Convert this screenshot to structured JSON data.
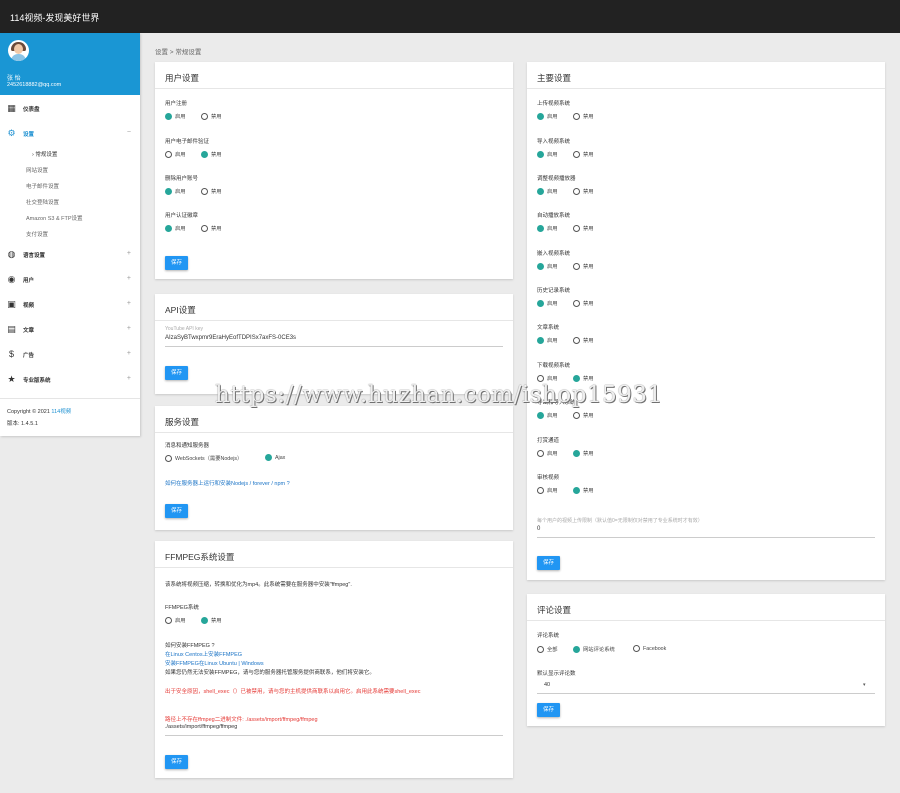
{
  "app_title": "114视频-发现美好世界",
  "user": {
    "name": "张 怡",
    "email": "2452618882@qq.com"
  },
  "sidebar": {
    "items": [
      {
        "label": "仪表盘",
        "sign": ""
      },
      {
        "label": "设置",
        "sign": "−"
      },
      {
        "label": "语言设置",
        "sign": "+"
      },
      {
        "label": "用户",
        "sign": "+"
      },
      {
        "label": "视频",
        "sign": "+"
      },
      {
        "label": "文章",
        "sign": "+"
      },
      {
        "label": "广告",
        "sign": "+"
      },
      {
        "label": "专业版系统",
        "sign": "+"
      }
    ],
    "sub_items": [
      "› 常规设置",
      "网站设置",
      "电子邮件设置",
      "社交登陆设置",
      "Amazon S3 & FTP设置",
      "支付设置"
    ],
    "copyright_prefix": "Copyright © 2021",
    "copyright_link": "114视频",
    "version": "版本: 1.4.5.1"
  },
  "breadcrumb": "设置 > 常规设置",
  "save_label": "保存",
  "user_settings": {
    "title": "用户设置",
    "fields": [
      {
        "label": "用户注册",
        "options": [
          "启用",
          "禁用"
        ],
        "selected": 0
      },
      {
        "label": "用户电子邮件验证",
        "options": [
          "启用",
          "禁用"
        ],
        "selected": 1
      },
      {
        "label": "删除用户账号",
        "options": [
          "启用",
          "禁用"
        ],
        "selected": 0
      },
      {
        "label": "用户认证徽章",
        "options": [
          "启用",
          "禁用"
        ],
        "selected": 0
      }
    ]
  },
  "api_settings": {
    "title": "API设置",
    "placeholder": "YouTube API key",
    "value": "AIzaSyBTwxpmr9EraHyEofTDPISx7axFS-0CE3s"
  },
  "server_settings": {
    "title": "服务设置",
    "field_label": "消息和通知服务器",
    "options": [
      "WebSockets（需要Nodejs）",
      "Ajax"
    ],
    "selected": 1,
    "link": "如何在服务器上运行和安装Nodejs / forever / npm ?"
  },
  "ffmpeg_settings": {
    "title": "FFMPEG系统设置",
    "intro": "该系统将视频压缩，转换和优化为mp4。此系统需要在服务器中安装\"ffmpeg\".",
    "field_label": "FFMPEG系统",
    "options": [
      "启用",
      "禁用"
    ],
    "selected": 1,
    "how_to": "如何安装FFMPEG ?",
    "link1": "在Linux Centos上安装FFMPEG",
    "link2": "安装FFMPEG在Linux Ubuntu | Windows",
    "note": "如果您仍然无法安装FFMPEG，请与您的服务器托管服务提供商联系，他们将安装它。",
    "warning": "出于安全原因，shell_exec（）已被禁用，请与您的主机提供商联系以启用它。启用此系统需要shell_exec",
    "error": "路径上不存在ffmpeg二进制文件: ./assets/import/ffmpeg/ffmpeg",
    "path_value": "./assets/import/ffmpeg/ffmpeg"
  },
  "main_settings": {
    "title": "主要设置",
    "fields": [
      {
        "label": "上传视频系统",
        "options": [
          "启用",
          "禁用"
        ],
        "selected": 0
      },
      {
        "label": "导入视频系统",
        "options": [
          "启用",
          "禁用"
        ],
        "selected": 0
      },
      {
        "label": "调整视频播放器",
        "options": [
          "启用",
          "禁用"
        ],
        "selected": 0
      },
      {
        "label": "自动播放系统",
        "options": [
          "启用",
          "禁用"
        ],
        "selected": 0
      },
      {
        "label": "嵌入视频系统",
        "options": [
          "启用",
          "禁用"
        ],
        "selected": 0
      },
      {
        "label": "历史记录系统",
        "options": [
          "启用",
          "禁用"
        ],
        "selected": 0
      },
      {
        "label": "文章系统",
        "options": [
          "启用",
          "禁用"
        ],
        "selected": 0
      },
      {
        "label": "下载视频系统",
        "options": [
          "启用",
          "禁用"
        ],
        "selected": 1
      },
      {
        "label": "导出和导入系统",
        "options": [
          "启用",
          "禁用"
        ],
        "selected": 0
      },
      {
        "label": "打赏通道",
        "options": [
          "启用",
          "禁用"
        ],
        "selected": 1
      },
      {
        "label": "审核视频",
        "options": [
          "启用",
          "禁用"
        ],
        "selected": 1
      }
    ],
    "limit_label": "每个用户的视频上传限制（默认值0=无限制仅对禁用了专业系统时才有效）",
    "limit_value": "0"
  },
  "comment_settings": {
    "title": "评论设置",
    "field_label": "评论系统",
    "options": [
      "全部",
      "网站评论系统",
      "Facebook"
    ],
    "selected": 1,
    "default_label": "默认显示评论数",
    "default_value": "40"
  },
  "watermark": "https://www.huzhan.com/ishop15931",
  "colors": {
    "accent": "#1a96d4",
    "radio_on": "#26a69a",
    "button": "#2196f3",
    "topbar": "#222222"
  }
}
